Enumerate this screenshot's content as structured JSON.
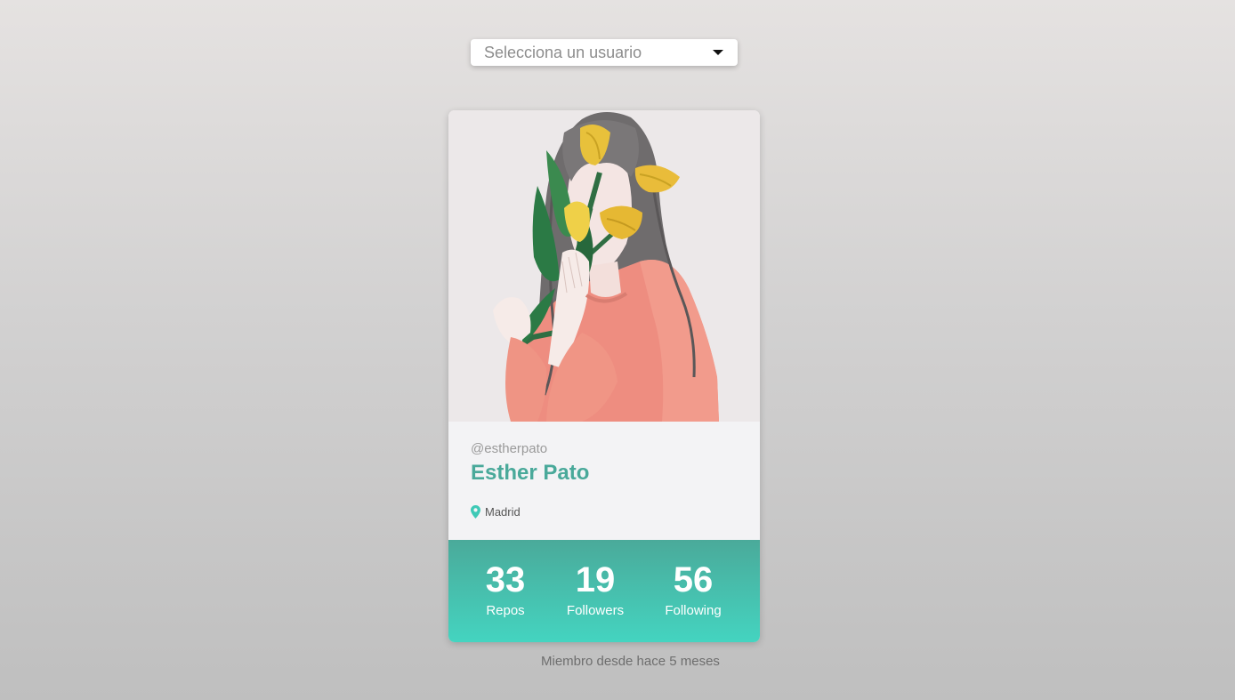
{
  "selector": {
    "placeholder": "Selecciona un usuario",
    "caret_icon": "caret-down-icon"
  },
  "profile": {
    "avatar_alt": "avatar",
    "username": "@estherpato",
    "name": "Esther Pato",
    "location": "Madrid",
    "location_icon": "map-marker-icon",
    "stats": {
      "repos": {
        "value": "33",
        "label": "Repos"
      },
      "followers": {
        "value": "19",
        "label": "Followers"
      },
      "following": {
        "value": "56",
        "label": "Following"
      }
    }
  },
  "member_since": "Miembro desde hace 5 meses",
  "colors": {
    "accent": "#49a99a",
    "stats_gradient_top": "#4aaa9a",
    "stats_gradient_bottom": "#44d4c0",
    "location_icon": "#3ec9b6"
  }
}
